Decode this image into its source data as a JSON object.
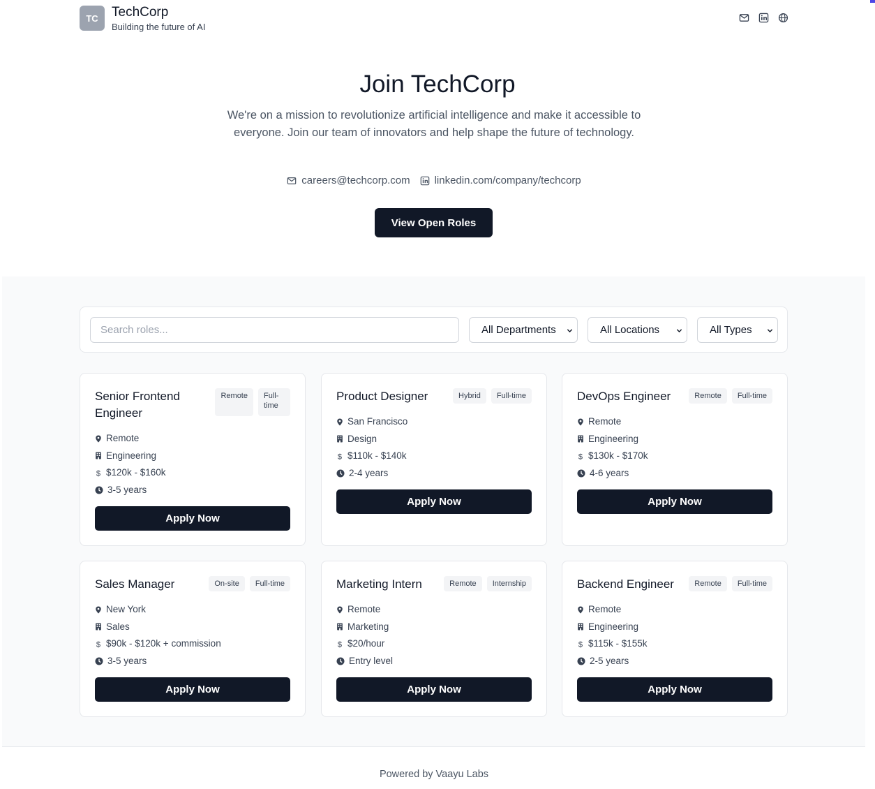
{
  "company": {
    "logo_initials": "TC",
    "name": "TechCorp",
    "tagline": "Building the future of AI"
  },
  "header_icons": [
    "mail-icon",
    "linkedin-icon",
    "globe-icon"
  ],
  "hero": {
    "title": "Join TechCorp",
    "description": "We're on a mission to revolutionize artificial intelligence and make it accessible to everyone. Join our team of innovators and help shape the future of technology.",
    "email": "careers@techcorp.com",
    "linkedin": "linkedin.com/company/techcorp",
    "cta_label": "View Open Roles"
  },
  "filters": {
    "search_placeholder": "Search roles...",
    "department": "All Departments",
    "location": "All Locations",
    "type": "All Types"
  },
  "jobs": [
    {
      "title": "Senior Frontend Engineer",
      "work_mode": "Remote",
      "employment_type": "Full-time",
      "location": "Remote",
      "department": "Engineering",
      "salary": "$120k - $160k",
      "experience": "3-5 years",
      "apply_label": "Apply Now"
    },
    {
      "title": "Product Designer",
      "work_mode": "Hybrid",
      "employment_type": "Full-time",
      "location": "San Francisco",
      "department": "Design",
      "salary": "$110k - $140k",
      "experience": "2-4 years",
      "apply_label": "Apply Now"
    },
    {
      "title": "DevOps Engineer",
      "work_mode": "Remote",
      "employment_type": "Full-time",
      "location": "Remote",
      "department": "Engineering",
      "salary": "$130k - $170k",
      "experience": "4-6 years",
      "apply_label": "Apply Now"
    },
    {
      "title": "Sales Manager",
      "work_mode": "On-site",
      "employment_type": "Full-time",
      "location": "New York",
      "department": "Sales",
      "salary": "$90k - $120k + commission",
      "experience": "3-5 years",
      "apply_label": "Apply Now"
    },
    {
      "title": "Marketing Intern",
      "work_mode": "Remote",
      "employment_type": "Internship",
      "location": "Remote",
      "department": "Marketing",
      "salary": "$20/hour",
      "experience": "Entry level",
      "apply_label": "Apply Now"
    },
    {
      "title": "Backend Engineer",
      "work_mode": "Remote",
      "employment_type": "Full-time",
      "location": "Remote",
      "department": "Engineering",
      "salary": "$115k - $155k",
      "experience": "2-5 years",
      "apply_label": "Apply Now"
    }
  ],
  "footer": {
    "text": "Powered by Vaayu Labs"
  },
  "colors": {
    "primary": "#111827",
    "muted_text": "#4b5563",
    "band_background": "#f9fafb",
    "tag_background": "#f3f4f6",
    "logo_background": "#9ca3af"
  }
}
